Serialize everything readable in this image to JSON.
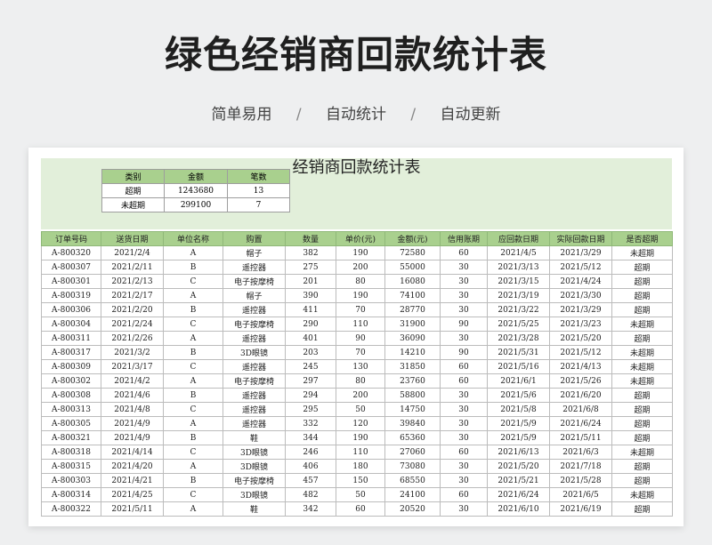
{
  "hero": {
    "title": "绿色经销商回款统计表",
    "tags": [
      "简单易用",
      "自动统计",
      "自动更新"
    ],
    "separator": "/"
  },
  "sheet": {
    "title": "经销商回款统计表",
    "summary": {
      "headers": [
        "类别",
        "金额",
        "笔数"
      ],
      "rows": [
        [
          "超期",
          "1243680",
          "13"
        ],
        [
          "未超期",
          "299100",
          "7"
        ]
      ]
    },
    "table": {
      "headers": [
        "订单号码",
        "送货日期",
        "单位名称",
        "购置",
        "数量",
        "单价(元)",
        "金额(元)",
        "信用账期",
        "应回款日期",
        "实际回款日期",
        "是否超期"
      ],
      "rows": [
        [
          "A-800320",
          "2021/2/4",
          "A",
          "帽子",
          "382",
          "190",
          "72580",
          "60",
          "2021/4/5",
          "2021/3/29",
          "未超期"
        ],
        [
          "A-800307",
          "2021/2/11",
          "B",
          "遥控器",
          "275",
          "200",
          "55000",
          "30",
          "2021/3/13",
          "2021/5/12",
          "超期"
        ],
        [
          "A-800301",
          "2021/2/13",
          "C",
          "电子按摩椅",
          "201",
          "80",
          "16080",
          "30",
          "2021/3/15",
          "2021/4/24",
          "超期"
        ],
        [
          "A-800319",
          "2021/2/17",
          "A",
          "帽子",
          "390",
          "190",
          "74100",
          "30",
          "2021/3/19",
          "2021/3/30",
          "超期"
        ],
        [
          "A-800306",
          "2021/2/20",
          "B",
          "遥控器",
          "411",
          "70",
          "28770",
          "30",
          "2021/3/22",
          "2021/3/29",
          "超期"
        ],
        [
          "A-800304",
          "2021/2/24",
          "C",
          "电子按摩椅",
          "290",
          "110",
          "31900",
          "90",
          "2021/5/25",
          "2021/3/23",
          "未超期"
        ],
        [
          "A-800311",
          "2021/2/26",
          "A",
          "遥控器",
          "401",
          "90",
          "36090",
          "30",
          "2021/3/28",
          "2021/5/20",
          "超期"
        ],
        [
          "A-800317",
          "2021/3/2",
          "B",
          "3D眼镜",
          "203",
          "70",
          "14210",
          "90",
          "2021/5/31",
          "2021/5/12",
          "未超期"
        ],
        [
          "A-800309",
          "2021/3/17",
          "C",
          "遥控器",
          "245",
          "130",
          "31850",
          "60",
          "2021/5/16",
          "2021/4/13",
          "未超期"
        ],
        [
          "A-800302",
          "2021/4/2",
          "A",
          "电子按摩椅",
          "297",
          "80",
          "23760",
          "60",
          "2021/6/1",
          "2021/5/26",
          "未超期"
        ],
        [
          "A-800308",
          "2021/4/6",
          "B",
          "遥控器",
          "294",
          "200",
          "58800",
          "30",
          "2021/5/6",
          "2021/6/20",
          "超期"
        ],
        [
          "A-800313",
          "2021/4/8",
          "C",
          "遥控器",
          "295",
          "50",
          "14750",
          "30",
          "2021/5/8",
          "2021/6/8",
          "超期"
        ],
        [
          "A-800305",
          "2021/4/9",
          "A",
          "遥控器",
          "332",
          "120",
          "39840",
          "30",
          "2021/5/9",
          "2021/6/24",
          "超期"
        ],
        [
          "A-800321",
          "2021/4/9",
          "B",
          "鞋",
          "344",
          "190",
          "65360",
          "30",
          "2021/5/9",
          "2021/5/11",
          "超期"
        ],
        [
          "A-800318",
          "2021/4/14",
          "C",
          "3D眼镜",
          "246",
          "110",
          "27060",
          "60",
          "2021/6/13",
          "2021/6/3",
          "未超期"
        ],
        [
          "A-800315",
          "2021/4/20",
          "A",
          "3D眼镜",
          "406",
          "180",
          "73080",
          "30",
          "2021/5/20",
          "2021/7/18",
          "超期"
        ],
        [
          "A-800303",
          "2021/4/21",
          "B",
          "电子按摩椅",
          "457",
          "150",
          "68550",
          "30",
          "2021/5/21",
          "2021/5/28",
          "超期"
        ],
        [
          "A-800314",
          "2021/4/25",
          "C",
          "3D眼镜",
          "482",
          "50",
          "24100",
          "60",
          "2021/6/24",
          "2021/6/5",
          "未超期"
        ],
        [
          "A-800322",
          "2021/5/11",
          "A",
          "鞋",
          "342",
          "60",
          "20520",
          "30",
          "2021/6/10",
          "2021/6/19",
          "超期"
        ]
      ]
    }
  }
}
